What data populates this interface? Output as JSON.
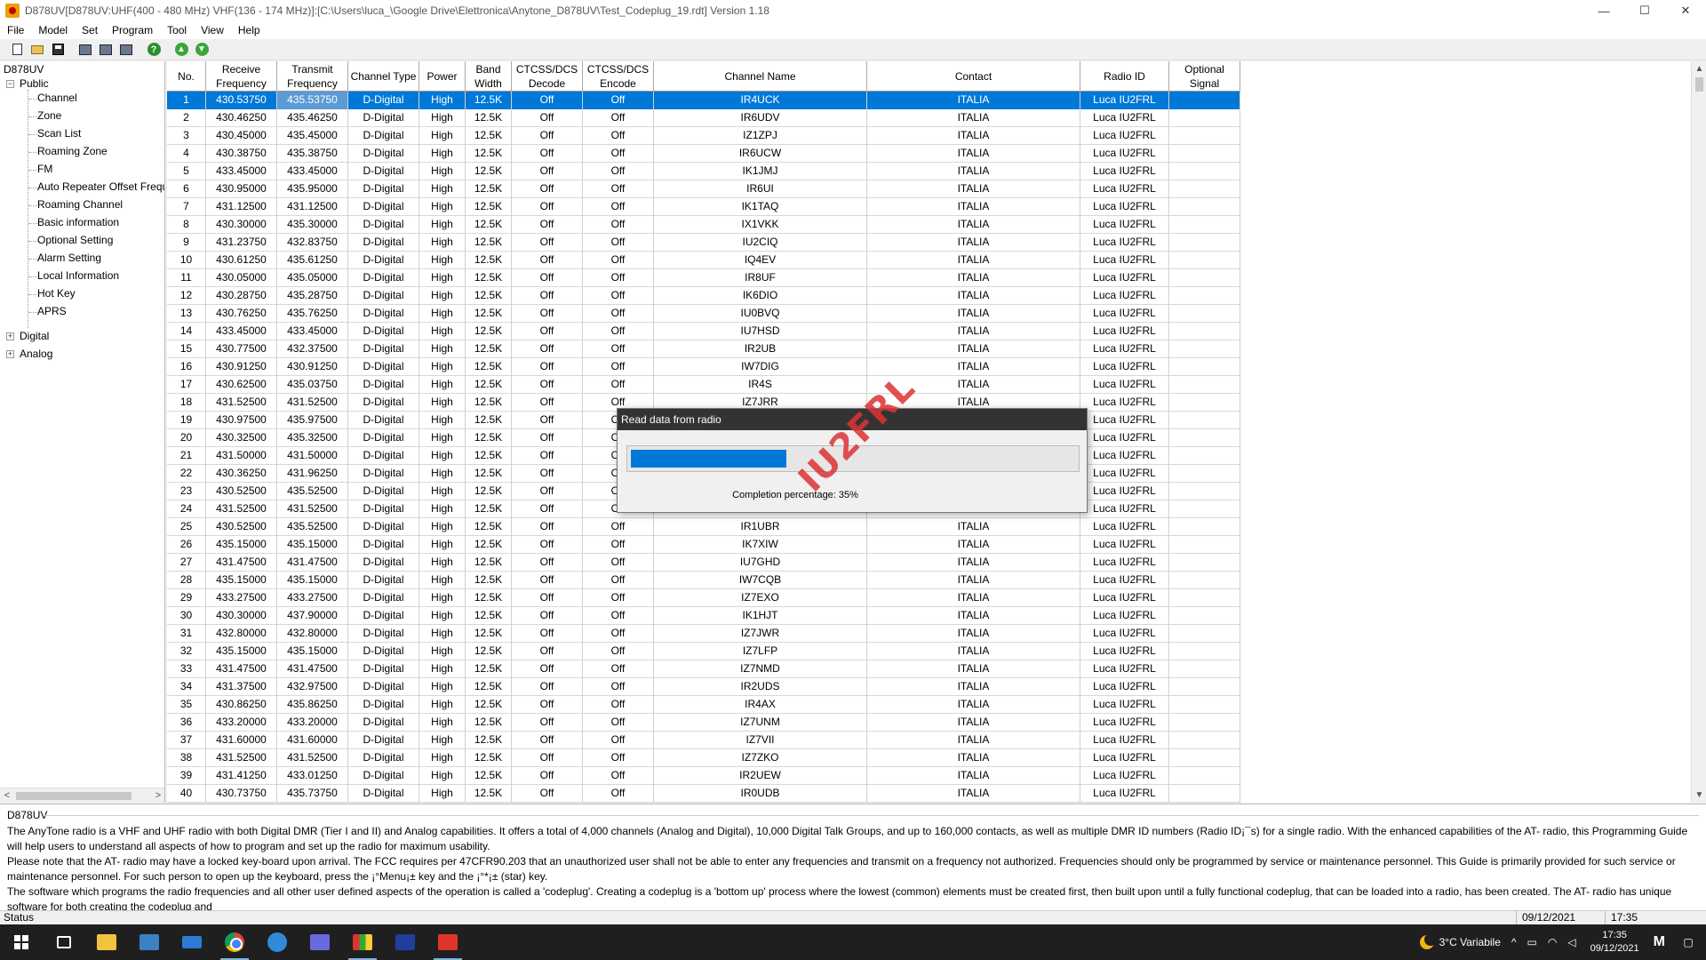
{
  "window": {
    "title": "D878UV[D878UV:UHF(400 - 480 MHz) VHF(136 - 174 MHz)]:[C:\\Users\\luca_\\Google Drive\\Elettronica\\Anytone_D878UV\\Test_Codeplug_19.rdt] Version 1.18",
    "minimize": "—",
    "maximize": "☐",
    "close": "✕"
  },
  "menu": [
    "File",
    "Model",
    "Set",
    "Program",
    "Tool",
    "View",
    "Help"
  ],
  "tree": {
    "root": "D878UV",
    "public": {
      "label": "Public",
      "expander": "−",
      "children": [
        "Channel",
        "Zone",
        "Scan List",
        "Roaming Zone",
        "FM",
        "Auto Repeater Offset Frequer",
        "Roaming Channel",
        "Basic information",
        "Optional Setting",
        "Alarm Setting",
        "Local Information",
        "Hot Key",
        "APRS"
      ]
    },
    "digital": {
      "label": "Digital",
      "expander": "+"
    },
    "analog": {
      "label": "Analog",
      "expander": "+"
    },
    "scroll_left": "<",
    "scroll_right": ">"
  },
  "grid": {
    "columns": [
      {
        "key": "no",
        "label": "No."
      },
      {
        "key": "rx",
        "label": "Receive Frequency"
      },
      {
        "key": "tx",
        "label": "Transmit Frequency"
      },
      {
        "key": "type",
        "label": "Channel Type"
      },
      {
        "key": "power",
        "label": "Power"
      },
      {
        "key": "bw",
        "label": "Band Width"
      },
      {
        "key": "dec",
        "label": "CTCSS/DCS Decode"
      },
      {
        "key": "enc",
        "label": "CTCSS/DCS Encode"
      },
      {
        "key": "name",
        "label": "Channel Name"
      },
      {
        "key": "contact",
        "label": "Contact"
      },
      {
        "key": "radio_id",
        "label": "Radio ID"
      },
      {
        "key": "opt",
        "label": "Optional Signal"
      }
    ],
    "common": {
      "type": "D-Digital",
      "power": "High",
      "bw": "12.5K",
      "dec": "Off",
      "enc": "Off",
      "contact": "ITALIA",
      "radio_id": "Luca IU2FRL",
      "opt": ""
    },
    "selected_row": 1,
    "rows": [
      {
        "no": "1",
        "rx": "430.53750",
        "tx": "435.53750",
        "name": "IR4UCK"
      },
      {
        "no": "2",
        "rx": "430.46250",
        "tx": "435.46250",
        "name": "IR6UDV"
      },
      {
        "no": "3",
        "rx": "430.45000",
        "tx": "435.45000",
        "name": "IZ1ZPJ"
      },
      {
        "no": "4",
        "rx": "430.38750",
        "tx": "435.38750",
        "name": "IR6UCW"
      },
      {
        "no": "5",
        "rx": "433.45000",
        "tx": "433.45000",
        "name": "IK1JMJ"
      },
      {
        "no": "6",
        "rx": "430.95000",
        "tx": "435.95000",
        "name": "IR6UI"
      },
      {
        "no": "7",
        "rx": "431.12500",
        "tx": "431.12500",
        "name": "IK1TAQ"
      },
      {
        "no": "8",
        "rx": "430.30000",
        "tx": "435.30000",
        "name": "IX1VKK"
      },
      {
        "no": "9",
        "rx": "431.23750",
        "tx": "432.83750",
        "name": "IU2CIQ"
      },
      {
        "no": "10",
        "rx": "430.61250",
        "tx": "435.61250",
        "name": "IQ4EV"
      },
      {
        "no": "11",
        "rx": "430.05000",
        "tx": "435.05000",
        "name": "IR8UF"
      },
      {
        "no": "12",
        "rx": "430.28750",
        "tx": "435.28750",
        "name": "IK6DIO"
      },
      {
        "no": "13",
        "rx": "430.76250",
        "tx": "435.76250",
        "name": "IU0BVQ"
      },
      {
        "no": "14",
        "rx": "433.45000",
        "tx": "433.45000",
        "name": "IU7HSD"
      },
      {
        "no": "15",
        "rx": "430.77500",
        "tx": "432.37500",
        "name": "IR2UB"
      },
      {
        "no": "16",
        "rx": "430.91250",
        "tx": "430.91250",
        "name": "IW7DIG"
      },
      {
        "no": "17",
        "rx": "430.62500",
        "tx": "435.03750",
        "name": "IR4S"
      },
      {
        "no": "18",
        "rx": "431.52500",
        "tx": "431.52500",
        "name": "IZ7JRR"
      },
      {
        "no": "19",
        "rx": "430.97500",
        "tx": "435.97500",
        "name": ""
      },
      {
        "no": "20",
        "rx": "430.32500",
        "tx": "435.32500",
        "name": ""
      },
      {
        "no": "21",
        "rx": "431.50000",
        "tx": "431.50000",
        "name": ""
      },
      {
        "no": "22",
        "rx": "430.36250",
        "tx": "431.96250",
        "name": ""
      },
      {
        "no": "23",
        "rx": "430.52500",
        "tx": "435.52500",
        "name": ""
      },
      {
        "no": "24",
        "rx": "431.52500",
        "tx": "431.52500",
        "name": ""
      },
      {
        "no": "25",
        "rx": "430.52500",
        "tx": "435.52500",
        "name": "IR1UBR"
      },
      {
        "no": "26",
        "rx": "435.15000",
        "tx": "435.15000",
        "name": "IK7XIW"
      },
      {
        "no": "27",
        "rx": "431.47500",
        "tx": "431.47500",
        "name": "IU7GHD"
      },
      {
        "no": "28",
        "rx": "435.15000",
        "tx": "435.15000",
        "name": "IW7CQB"
      },
      {
        "no": "29",
        "rx": "433.27500",
        "tx": "433.27500",
        "name": "IZ7EXO"
      },
      {
        "no": "30",
        "rx": "430.30000",
        "tx": "437.90000",
        "name": "IK1HJT"
      },
      {
        "no": "31",
        "rx": "432.80000",
        "tx": "432.80000",
        "name": "IZ7JWR"
      },
      {
        "no": "32",
        "rx": "435.15000",
        "tx": "435.15000",
        "name": "IZ7LFP"
      },
      {
        "no": "33",
        "rx": "431.47500",
        "tx": "431.47500",
        "name": "IZ7NMD"
      },
      {
        "no": "34",
        "rx": "431.37500",
        "tx": "432.97500",
        "name": "IR2UDS"
      },
      {
        "no": "35",
        "rx": "430.86250",
        "tx": "435.86250",
        "name": "IR4AX"
      },
      {
        "no": "36",
        "rx": "433.20000",
        "tx": "433.20000",
        "name": "IZ7UNM"
      },
      {
        "no": "37",
        "rx": "431.60000",
        "tx": "431.60000",
        "name": "IZ7VII"
      },
      {
        "no": "38",
        "rx": "431.52500",
        "tx": "431.52500",
        "name": "IZ7ZKO"
      },
      {
        "no": "39",
        "rx": "431.41250",
        "tx": "433.01250",
        "name": "IR2UEW"
      },
      {
        "no": "40",
        "rx": "430.73750",
        "tx": "435.73750",
        "name": "IR0UDB"
      }
    ],
    "scroll_up": "▲",
    "scroll_down": "▼"
  },
  "dialog": {
    "title": "Read data from radio",
    "progress": 0.35,
    "label": "Completion percentage: 35%",
    "watermark": "IU2FRL"
  },
  "info": {
    "title": "D878UV",
    "paragraphs": [
      "The AnyTone  radio is a VHF and UHF radio with both Digital DMR (Tier I and II) and Analog capabilities. It offers a total of 4,000 channels (Analog and Digital), 10,000 Digital Talk Groups, and up to 160,000 contacts, as well as multiple DMR ID numbers (Radio ID¡¯s) for a single radio. With the enhanced capabilities of the AT- radio, this Programming Guide will help users to understand all aspects of how to program and set up the radio for maximum usability.",
      "  Please note that the AT- radio may have a locked key-board upon arrival. The FCC requires per 47CFR90.203 that an unauthorized user shall not be able to enter any frequencies and transmit on a frequency not authorized. Frequencies should only be programmed by service or maintenance personnel. This Guide is primarily provided for such service or maintenance personnel. For such person to open up the keyboard, press the ¡°Menu¡± key and the ¡°*¡± (star) key.",
      "  The software which programs the radio frequencies and all other user defined aspects of the operation is called a 'codeplug'. Creating a codeplug is a 'bottom up' process where the lowest (common) elements must be created first, then built upon until a fully functional codeplug, that can be loaded into a radio, has been created. The AT- radio has unique software for both creating the codeplug and"
    ]
  },
  "status": {
    "label": "Status",
    "date": "09/12/2021",
    "time": "17:35"
  },
  "taskbar": {
    "weather": "3°C  Variabile",
    "tray_up": "^",
    "clock_time": "17:35",
    "clock_date": "09/12/2021",
    "colors": {
      "accent": "#0078d7",
      "taskbar": "#1f1f1f"
    }
  }
}
